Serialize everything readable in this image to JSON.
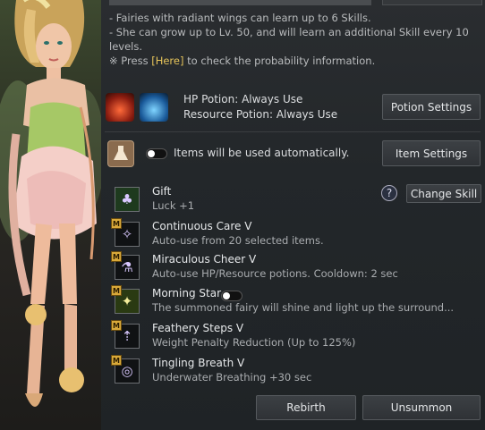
{
  "info": {
    "line1": "- Fairies with radiant wings can learn up to 6 Skills.",
    "line2": "- She can grow up to Lv. 50, and will learn an additional Skill every 10 levels.",
    "line3_prefix": "※ Press ",
    "line3_link": "[Here]",
    "line3_suffix": " to check the probability information."
  },
  "potions": {
    "hp_label": "HP Potion: Always Use",
    "resource_label": "Resource Potion: Always Use",
    "settings_button": "Potion Settings"
  },
  "items": {
    "auto_label": "Items will be used automatically.",
    "settings_button": "Item Settings"
  },
  "help": {
    "label": "?"
  },
  "change_skill_button": "Change Skill",
  "skills": [
    {
      "name": "Gift",
      "desc": "Luck +1",
      "icon": "clover-icon",
      "glyph": "♣"
    },
    {
      "name": "Continuous Care V",
      "desc": "Auto-use from 20 selected items.",
      "icon": "fairy-icon",
      "badge": "M",
      "glyph": "✧"
    },
    {
      "name": "Miraculous Cheer V",
      "desc": "Auto-use HP/Resource potions. Cooldown: 2 sec",
      "icon": "potions-icon",
      "badge": "M",
      "glyph": "⚗"
    },
    {
      "name": "Morning Star",
      "desc": "The summoned fairy will shine and light up the surround...",
      "icon": "lantern-icon",
      "badge": "M",
      "glyph": "✦"
    },
    {
      "name": "Feathery Steps V",
      "desc": "Weight Penalty Reduction (Up to 125%)",
      "icon": "weight-icon",
      "badge": "M",
      "glyph": "⇡"
    },
    {
      "name": "Tingling Breath V",
      "desc": "Underwater Breathing +30 sec",
      "icon": "bubble-icon",
      "badge": "M",
      "glyph": "◎"
    }
  ],
  "footer": {
    "rebirth": "Rebirth",
    "unsummon": "Unsummon"
  }
}
